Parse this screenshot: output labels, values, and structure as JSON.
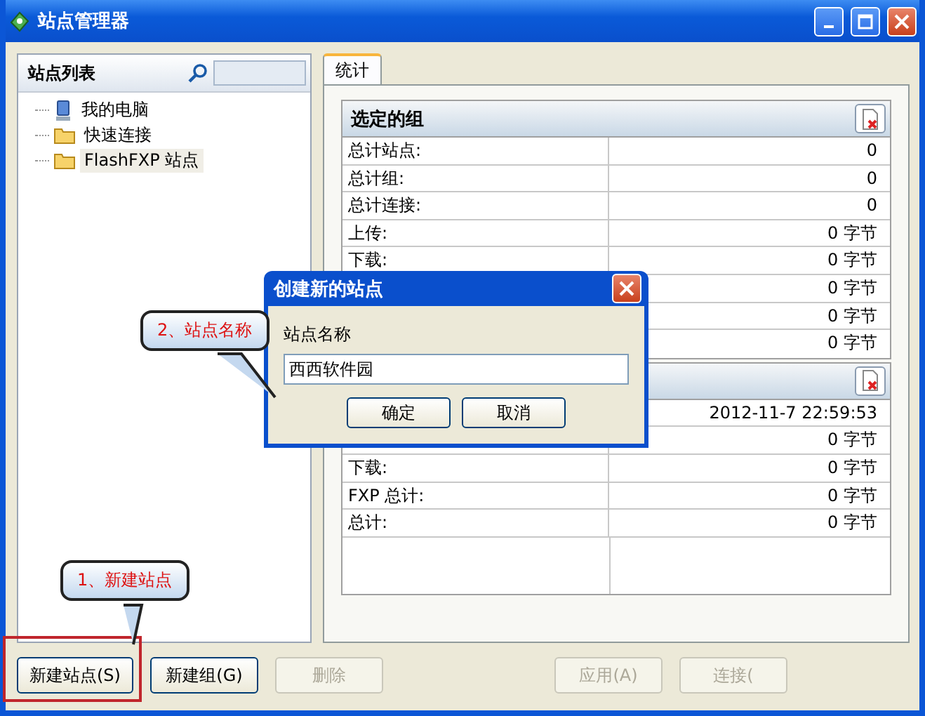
{
  "window": {
    "title": "站点管理器"
  },
  "sidebar": {
    "title": "站点列表",
    "items": [
      {
        "label": "我的电脑",
        "kind": "computer",
        "selected": false
      },
      {
        "label": "快速连接",
        "kind": "folder",
        "selected": false
      },
      {
        "label": "FlashFXP 站点",
        "kind": "folder",
        "selected": true
      }
    ]
  },
  "tabs": [
    {
      "label": "统计",
      "selected": true
    }
  ],
  "sections": [
    {
      "title": "选定的组",
      "rows": [
        {
          "label": "总计站点:",
          "value": "0"
        },
        {
          "label": "总计组:",
          "value": "0"
        },
        {
          "label": "总计连接:",
          "value": "0"
        },
        {
          "label": "上传:",
          "value": "0 字节"
        },
        {
          "label": "下载:",
          "value": "0 字节"
        },
        {
          "value": "0 字节"
        },
        {
          "value": "0 字节"
        },
        {
          "value": "0 字节"
        }
      ]
    },
    {
      "rows": [
        {
          "value": "2012-11-7 22:59:53"
        },
        {
          "value": "0 字节"
        },
        {
          "label": "下载:",
          "value": "0 字节"
        },
        {
          "label": "FXP 总计:",
          "value": "0 字节"
        },
        {
          "label": "总计:",
          "value": "0 字节"
        },
        {}
      ]
    }
  ],
  "buttons": [
    {
      "label": "新建站点(S)",
      "disabled": false,
      "highlighted": true
    },
    {
      "label": "新建组(G)",
      "disabled": false,
      "highlighted": false
    },
    {
      "label": "删除",
      "disabled": true,
      "highlighted": false
    },
    {
      "label": "应用(A)",
      "disabled": true,
      "highlighted": false
    },
    {
      "label": "连接(",
      "disabled": true,
      "highlighted": false
    }
  ],
  "dialog": {
    "title": "创建新的站点",
    "field_label": "站点名称",
    "value": "西西软件园",
    "buttons": [
      "确定",
      "取消"
    ]
  },
  "callouts": [
    {
      "text": "2、站点名称"
    },
    {
      "text": "1、新建站点"
    }
  ]
}
